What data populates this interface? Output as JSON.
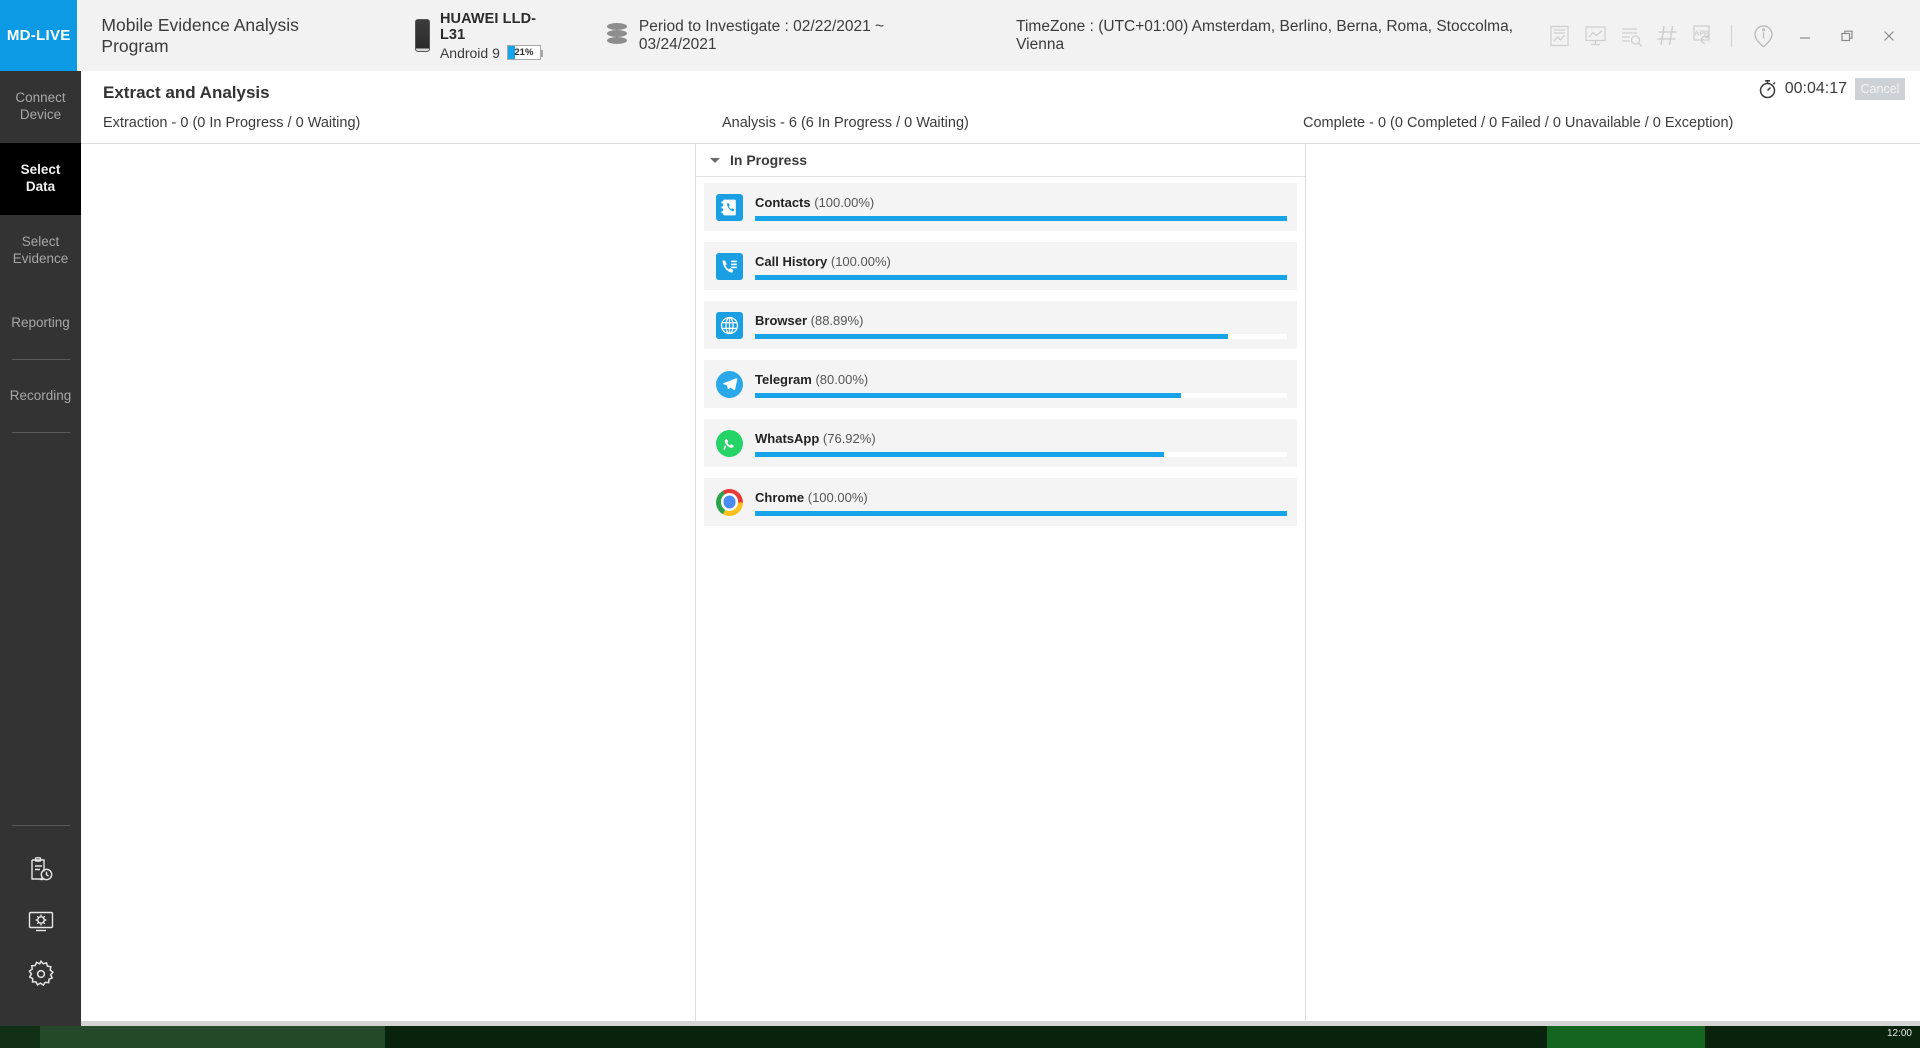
{
  "titlebar": {
    "brand": "MD-LIVE",
    "app_title": "Mobile Evidence Analysis Program",
    "device": {
      "name": "HUAWEI LLD-L31",
      "os": "Android 9",
      "battery_percent_label": "21%",
      "battery_percent": 21
    },
    "period": "Period to Investigate : 02/22/2021 ~ 03/24/2021",
    "timezone": "TimeZone : (UTC+01:00) Amsterdam, Berlino, Berna, Roma, Stoccolma, Vienna",
    "tools": [
      {
        "name": "report-document-icon"
      },
      {
        "name": "monitor-chart-icon"
      },
      {
        "name": "list-search-icon"
      },
      {
        "name": "hash-icon"
      },
      {
        "name": "app-refresh-icon"
      }
    ],
    "window_buttons": [
      {
        "name": "info-icon",
        "label": "i"
      },
      {
        "name": "minimize-button",
        "label": "–"
      },
      {
        "name": "restore-button",
        "label": "❐"
      },
      {
        "name": "close-button",
        "label": "×"
      }
    ]
  },
  "page": {
    "title": "Extract and Analysis",
    "timer": "00:04:17",
    "cancel_label": "Cancel",
    "status": {
      "extraction": "Extraction - 0 (0 In Progress / 0 Waiting)",
      "analysis": "Analysis - 6 (6 In Progress / 0 Waiting)",
      "complete": "Complete - 0 (0 Completed / 0 Failed / 0 Unavailable / 0 Exception)"
    }
  },
  "analysis_panel": {
    "section_title": "In Progress",
    "tasks": [
      {
        "name": "Contacts",
        "percent_label": "(100.00%)",
        "percent": 100.0,
        "icon": "contacts-icon"
      },
      {
        "name": "Call History",
        "percent_label": "(100.00%)",
        "percent": 100.0,
        "icon": "call-history-icon"
      },
      {
        "name": "Browser",
        "percent_label": "(88.89%)",
        "percent": 88.89,
        "icon": "browser-globe-icon"
      },
      {
        "name": "Telegram",
        "percent_label": "(80.00%)",
        "percent": 80.0,
        "icon": "telegram-icon"
      },
      {
        "name": "WhatsApp",
        "percent_label": "(76.92%)",
        "percent": 76.92,
        "icon": "whatsapp-icon"
      },
      {
        "name": "Chrome",
        "percent_label": "(100.00%)",
        "percent": 100.0,
        "icon": "chrome-icon"
      }
    ]
  },
  "sidebar": {
    "items": [
      {
        "label_line1": "Connect",
        "label_line2": "Device",
        "active": false
      },
      {
        "label_line1": "Select",
        "label_line2": "Data",
        "active": true
      },
      {
        "label_line1": "Select",
        "label_line2": "Evidence",
        "active": false
      },
      {
        "label_line1": "Reporting",
        "label_line2": "",
        "active": false
      },
      {
        "label_line1": "Recording",
        "label_line2": "",
        "active": false
      }
    ],
    "bottom_icons": [
      {
        "name": "history-clipboard-icon"
      },
      {
        "name": "system-settings-monitor-icon"
      },
      {
        "name": "settings-gear-icon"
      }
    ]
  },
  "colors": {
    "brand_blue": "#0c9ae5",
    "progress_blue": "#17a3e8",
    "sidebar_bg": "#333333",
    "active_nav_bg": "#000000"
  },
  "taskbar": {
    "clock": "12:00"
  }
}
